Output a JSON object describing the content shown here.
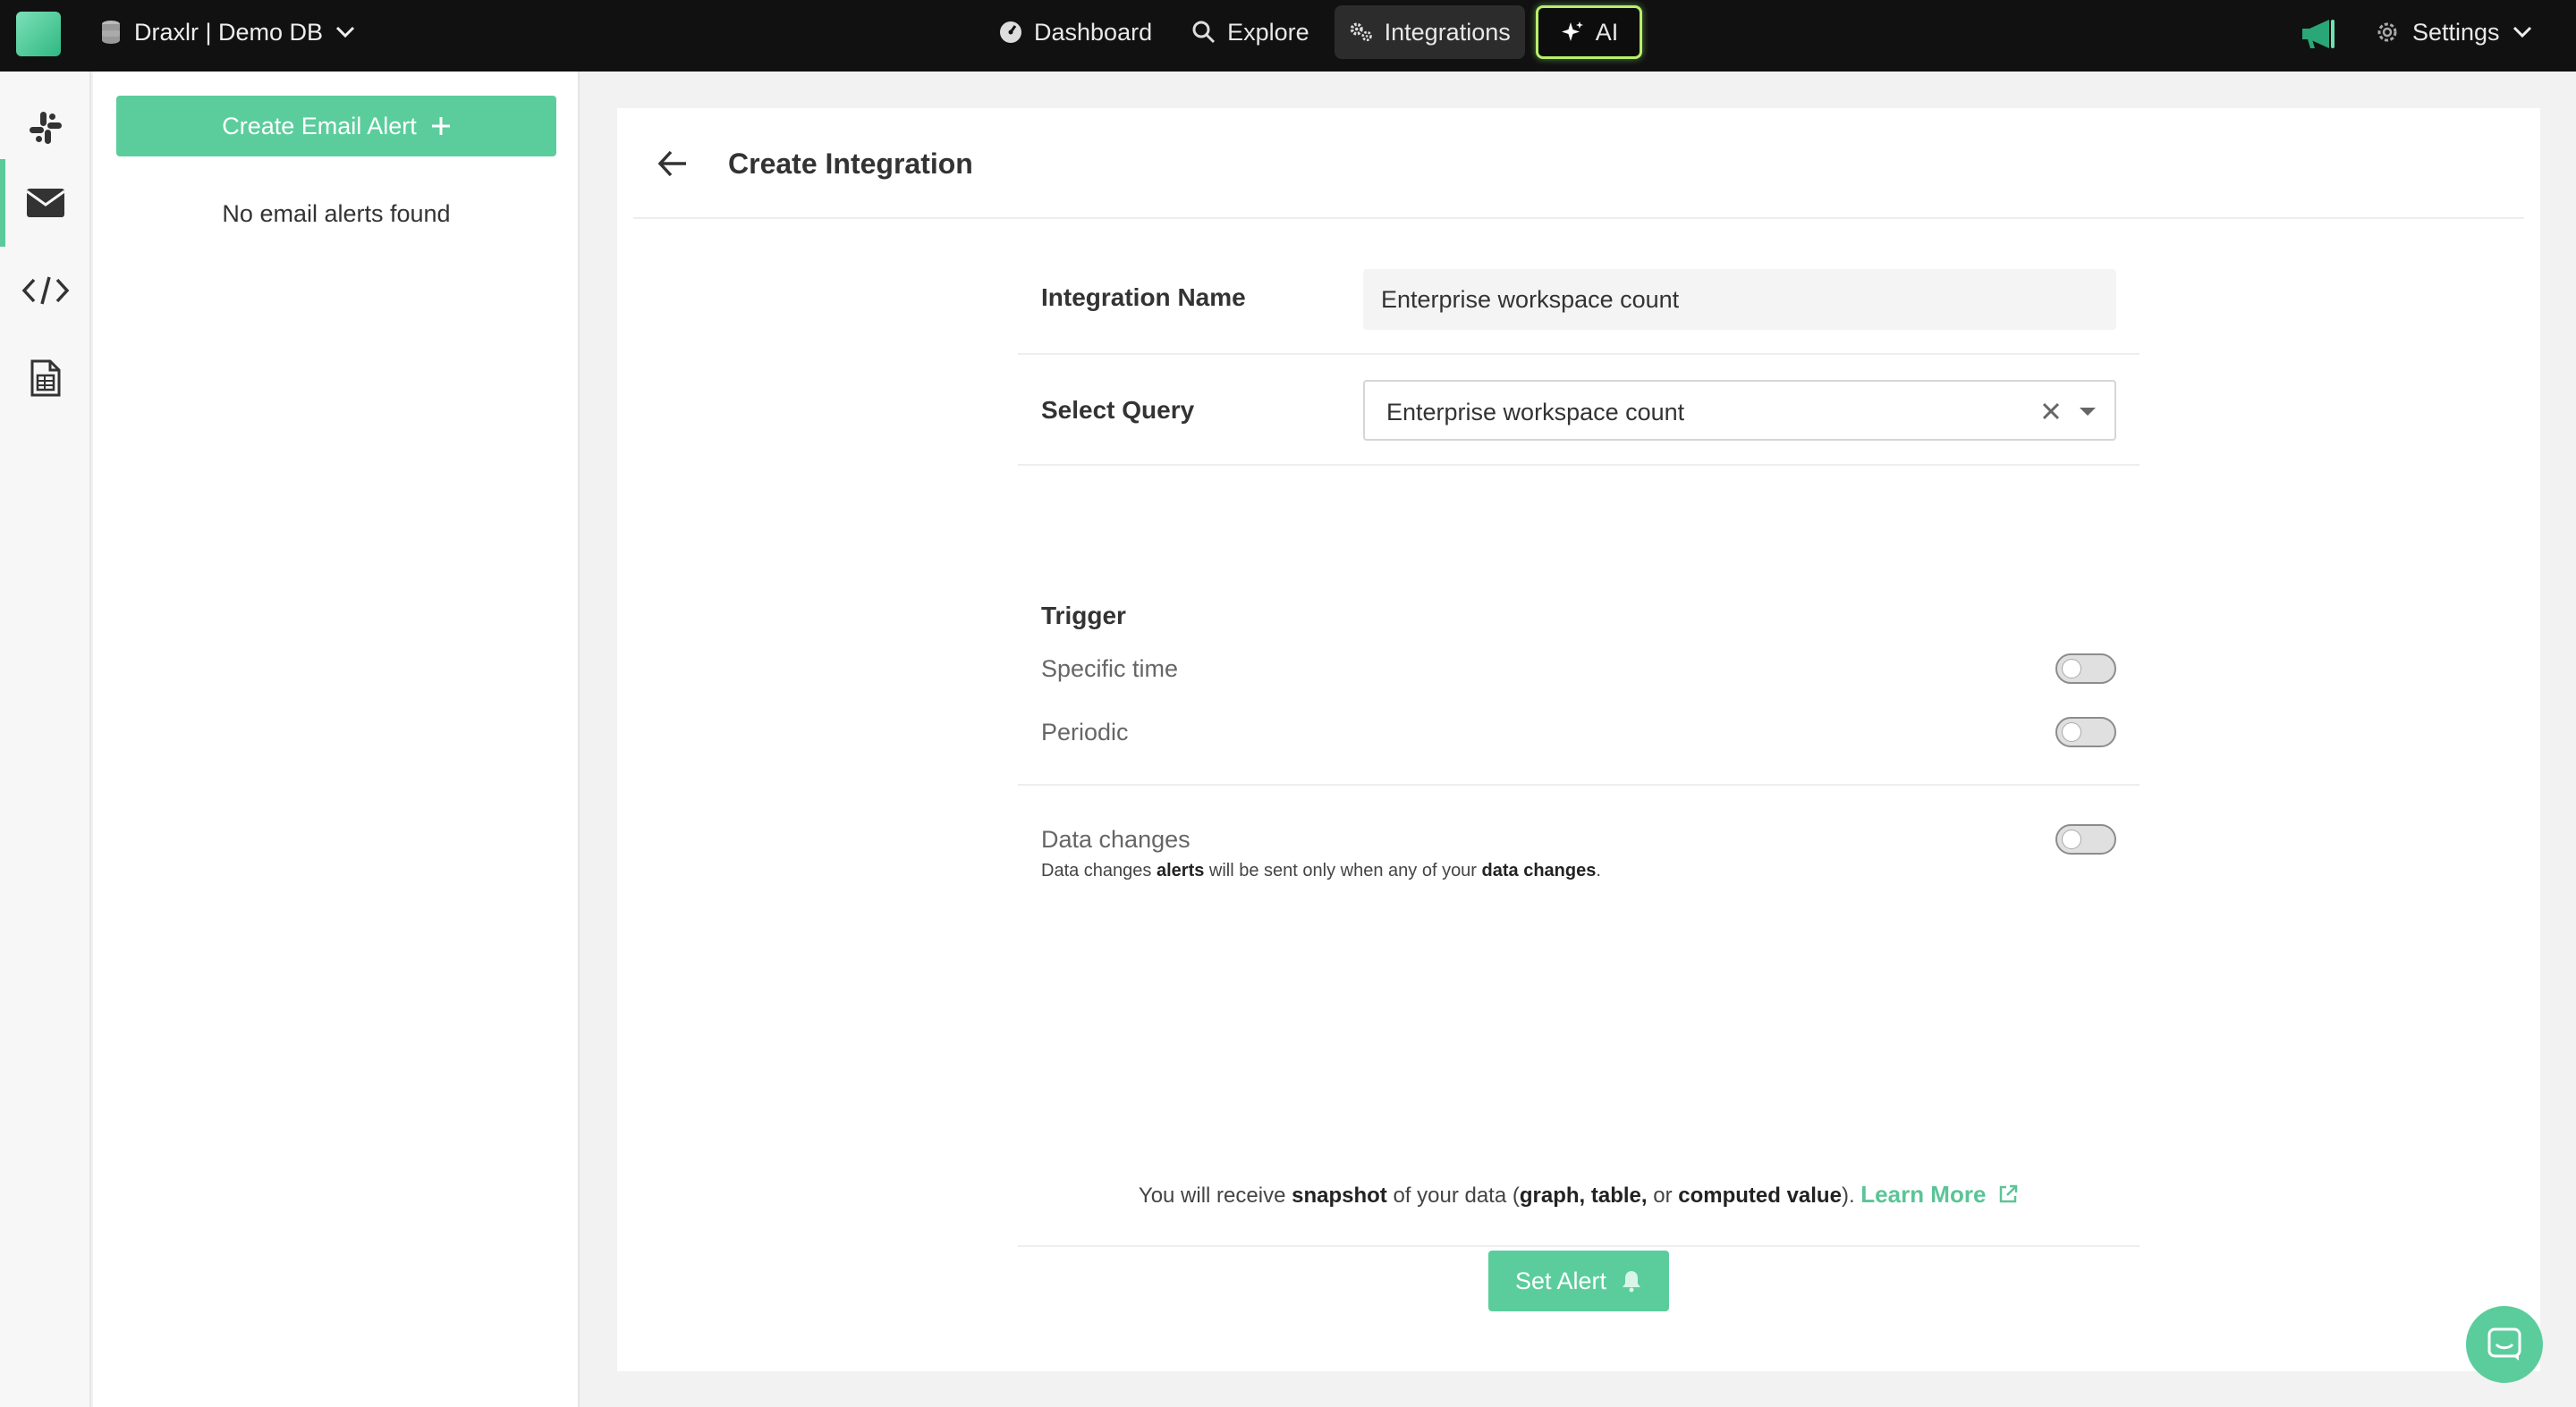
{
  "topbar": {
    "db_label": "Draxlr | Demo DB",
    "nav": {
      "dashboard": "Dashboard",
      "explore": "Explore",
      "integrations": "Integrations",
      "ai": "AI"
    },
    "settings": "Settings"
  },
  "rail": {
    "items": [
      "slack-icon",
      "email-icon",
      "code-icon",
      "sheet-icon"
    ],
    "active": "email-icon"
  },
  "left_panel": {
    "create_button": "Create Email Alert",
    "empty_text": "No email alerts found"
  },
  "main": {
    "title": "Create Integration",
    "integration_name_label": "Integration Name",
    "integration_name_value": "Enterprise workspace count",
    "select_query_label": "Select Query",
    "select_query_value": "Enterprise workspace count",
    "trigger_label": "Trigger",
    "specific_time_label": "Specific time",
    "periodic_label": "Periodic",
    "data_changes_label": "Data changes",
    "note": {
      "p1": "Data changes ",
      "b1": "alerts",
      "p2": " will be sent only when any of your ",
      "b2": "data changes",
      "p3": "."
    },
    "toggles": {
      "specific_time": false,
      "periodic": false,
      "data_changes": false
    },
    "footer": {
      "p1": "You will receive ",
      "b1": "snapshot",
      "p2": " of your data (",
      "b2": "graph, table,",
      "p3": " or ",
      "b3": "computed value",
      "p4": "). ",
      "learn_more": "Learn More"
    },
    "set_alert": "Set Alert"
  },
  "colors": {
    "accent": "#5bcd9c",
    "topbar_bg": "#111111",
    "ai_border": "#b9ef6a"
  }
}
